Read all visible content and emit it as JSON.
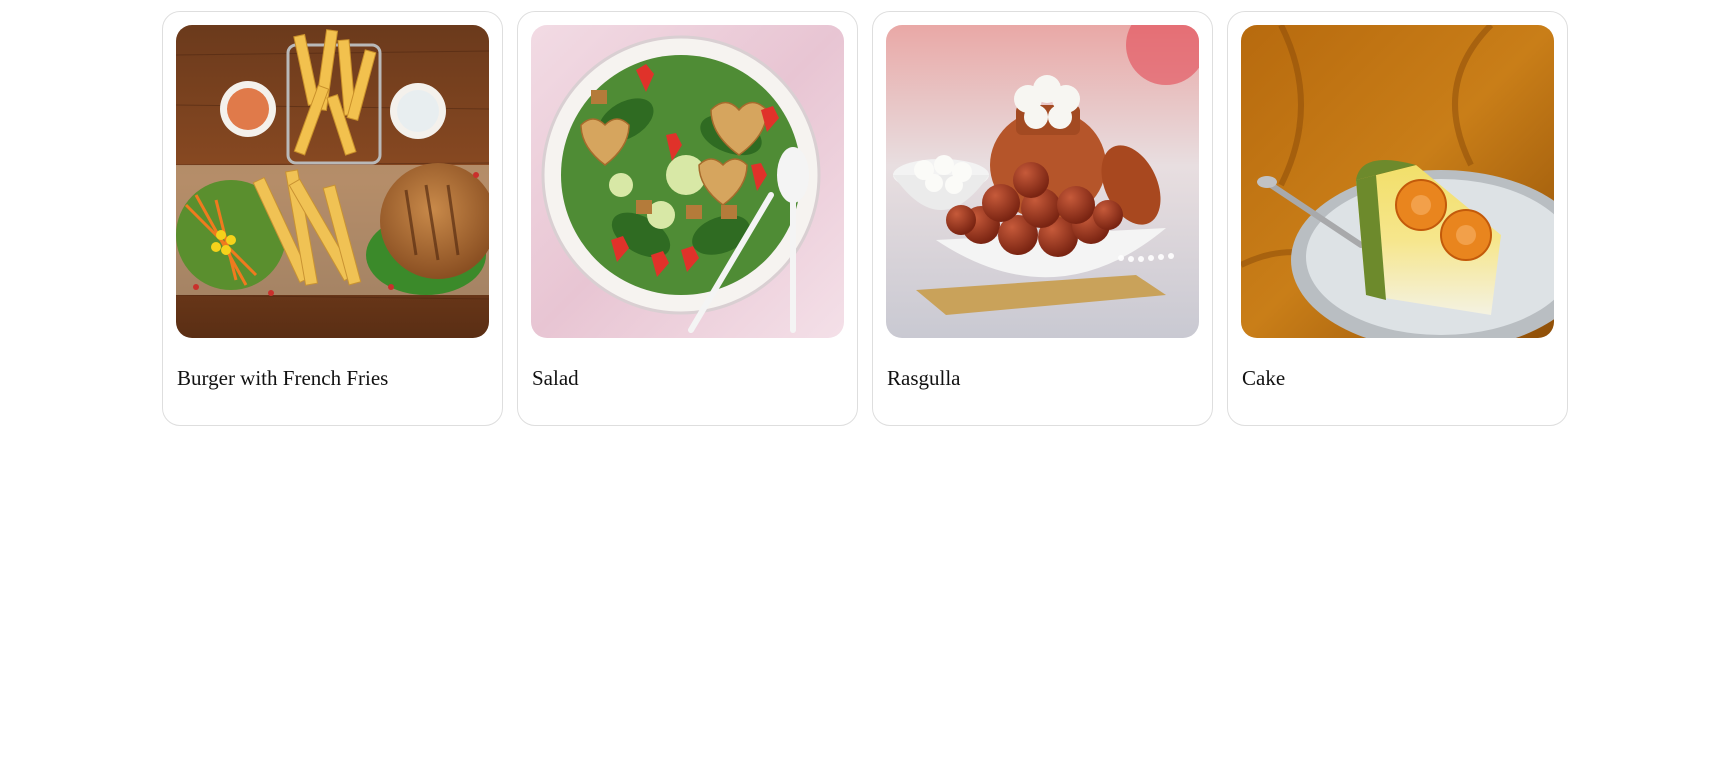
{
  "items": [
    {
      "title": "Burger with French Fries",
      "image": "burger-with-french-fries-photo"
    },
    {
      "title": "Salad",
      "image": "salad-photo"
    },
    {
      "title": "Rasgulla",
      "image": "rasgulla-photo"
    },
    {
      "title": "Cake",
      "image": "cake-photo"
    }
  ]
}
